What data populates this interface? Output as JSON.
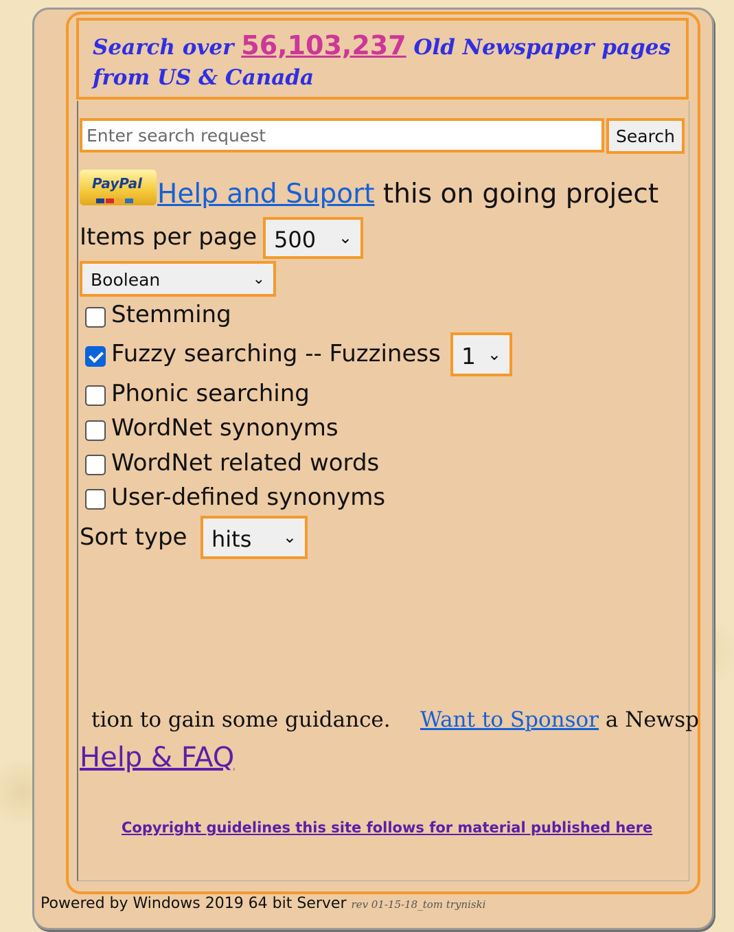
{
  "header": {
    "prefix": "Search over",
    "count": "56,103,237",
    "suffix": "Old Newspaper pages from US & Canada"
  },
  "search": {
    "placeholder": "Enter search request",
    "value": "",
    "button_label": "Search"
  },
  "support": {
    "paypal_logo_text": "PayPal",
    "link_text": "Help and Suport",
    "rest_text": " this on going project"
  },
  "items_per_page": {
    "label": "Items per page",
    "value": "500"
  },
  "search_mode": {
    "value": "Boolean"
  },
  "options": {
    "stemming": {
      "label": "Stemming",
      "checked": false
    },
    "fuzzy": {
      "label": "Fuzzy searching -- Fuzziness",
      "checked": true,
      "fuzziness": "1"
    },
    "phonic": {
      "label": "Phonic searching",
      "checked": false
    },
    "wordnet_synonyms": {
      "label": "WordNet synonyms",
      "checked": false
    },
    "wordnet_related": {
      "label": "WordNet related words",
      "checked": false
    },
    "user_synonyms": {
      "label": "User-defined synonyms",
      "checked": false
    }
  },
  "sort": {
    "label": "Sort type",
    "value": "hits"
  },
  "marquee": {
    "left_text": "tion to gain some guidance.",
    "sponsor_link": "Want to Sponsor",
    "sponsor_rest": " a Newsp"
  },
  "links": {
    "help_faq": "Help & FAQ",
    "copyright": "Copyright guidelines this site follows for material published here"
  },
  "footer": {
    "powered": "Powered by Windows 2019 64 bit Server ",
    "rev": "rev 01-15-18_tom tryniski"
  },
  "colors": {
    "panel_bg": "#edcba4",
    "orange_border": "#f39a2e",
    "header_text": "#2f2fe4",
    "count_pink": "#cc3799",
    "link_blue": "#1561d8",
    "visited_purple": "#5b1fa8"
  }
}
